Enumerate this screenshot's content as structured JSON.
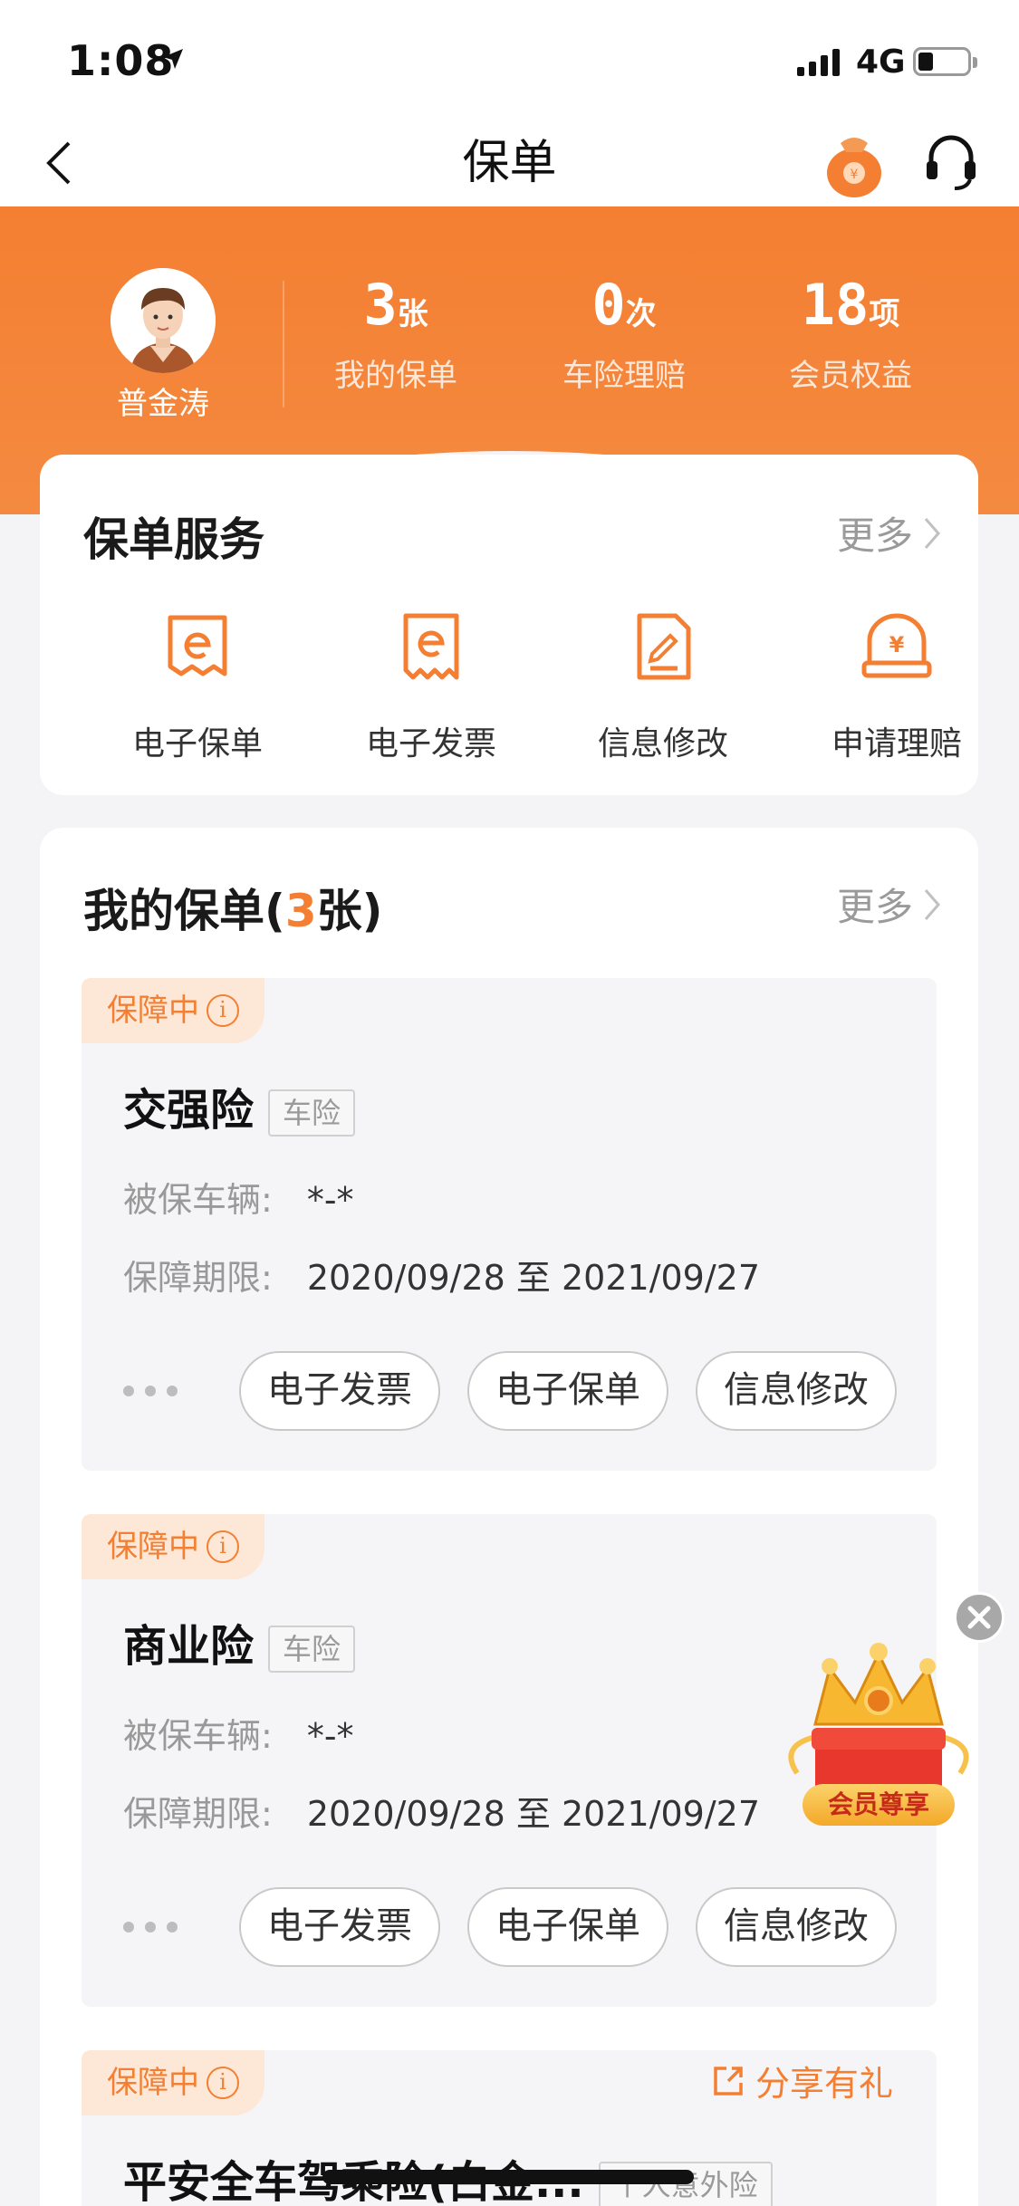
{
  "status_bar": {
    "time": "1:08",
    "network": "4G"
  },
  "nav": {
    "title": "保单"
  },
  "user": {
    "name": "普金涛"
  },
  "stats": [
    {
      "num": "3",
      "unit": "张",
      "label": "我的保单"
    },
    {
      "num": "0",
      "unit": "次",
      "label": "车险理赔"
    },
    {
      "num": "18",
      "unit": "项",
      "label": "会员权益"
    }
  ],
  "services": {
    "title": "保单服务",
    "more": "更多",
    "items": [
      {
        "label": "电子保单",
        "icon": "e-policy-icon"
      },
      {
        "label": "电子发票",
        "icon": "e-invoice-icon"
      },
      {
        "label": "信息修改",
        "icon": "edit-info-icon"
      },
      {
        "label": "申请理赔",
        "icon": "claim-icon"
      }
    ]
  },
  "policies": {
    "title_prefix": "我的保单(",
    "count": "3",
    "title_suffix": "张)",
    "more": "更多",
    "items": [
      {
        "status": "保障中",
        "name": "交强险",
        "type": "车险",
        "vehicle_label": "被保车辆:",
        "vehicle_value": "*-*",
        "period_label": "保障期限:",
        "period_value": "2020/09/28 至 2021/09/27",
        "buttons": [
          "电子发票",
          "电子保单",
          "信息修改"
        ]
      },
      {
        "status": "保障中",
        "name": "商业险",
        "type": "车险",
        "vehicle_label": "被保车辆:",
        "vehicle_value": "*-*",
        "period_label": "保障期限:",
        "period_value": "2020/09/28 至 2021/09/27",
        "buttons": [
          "电子发票",
          "电子保单",
          "信息修改"
        ]
      },
      {
        "status": "保障中",
        "name": "平安全车驾乘险(白金...",
        "type": "个人意外险",
        "share": "分享有礼"
      }
    ]
  },
  "float_badge": {
    "label": "会员尊享"
  },
  "colors": {
    "accent": "#f47f32",
    "tag_bg": "#fde8d8",
    "page_bg": "#f4f4f6"
  }
}
